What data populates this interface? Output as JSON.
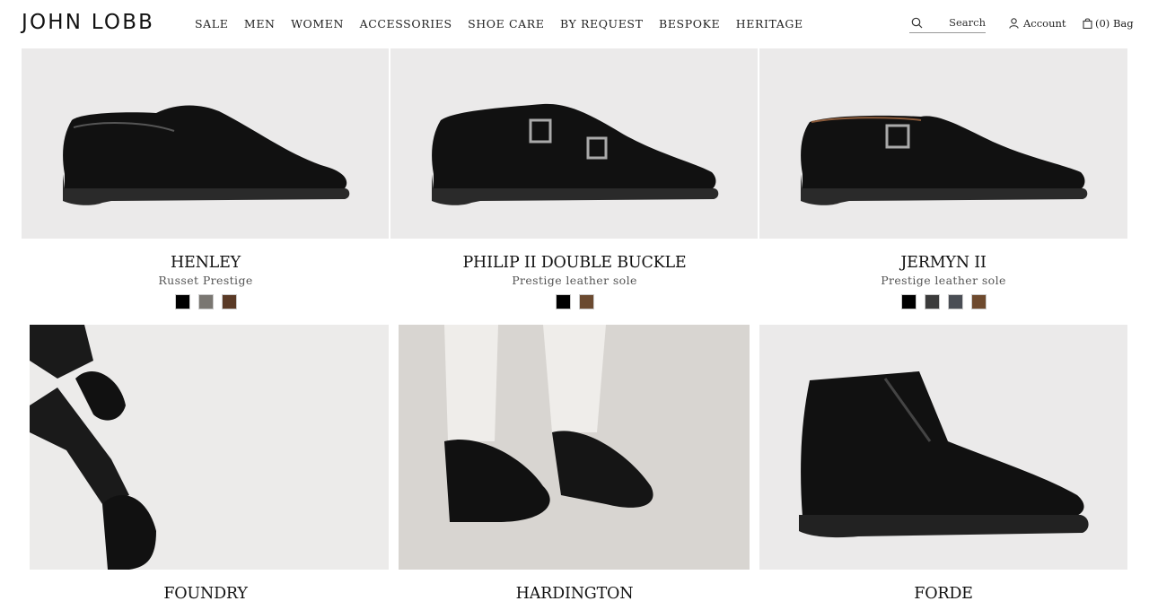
{
  "brand": "JOHN LOBB",
  "nav": [
    "SALE",
    "MEN",
    "WOMEN",
    "ACCESSORIES",
    "SHOE CARE",
    "BY REQUEST",
    "BESPOKE",
    "HERITAGE"
  ],
  "search": {
    "label": "Search"
  },
  "account": {
    "label": "Account"
  },
  "bag": {
    "label": "(0) Bag"
  },
  "products": [
    {
      "name": "HENLEY",
      "subtitle": "Russet Prestige",
      "swatches": [
        "#000000",
        "#7a7772",
        "#5a3a26"
      ]
    },
    {
      "name": "PHILIP II DOUBLE BUCKLE",
      "subtitle": "Prestige leather sole",
      "swatches": [
        "#000000",
        "#6b4a30"
      ]
    },
    {
      "name": "JERMYN II",
      "subtitle": "Prestige leather sole",
      "swatches": [
        "#000000",
        "#3b3b3b",
        "#4a4e55",
        "#6e4a2e"
      ]
    },
    {
      "name": "FOUNDRY"
    },
    {
      "name": "HARDINGTON"
    },
    {
      "name": "FORDE"
    }
  ],
  "colors": {
    "image_bg": "#ebeaea",
    "text": "#111111"
  }
}
